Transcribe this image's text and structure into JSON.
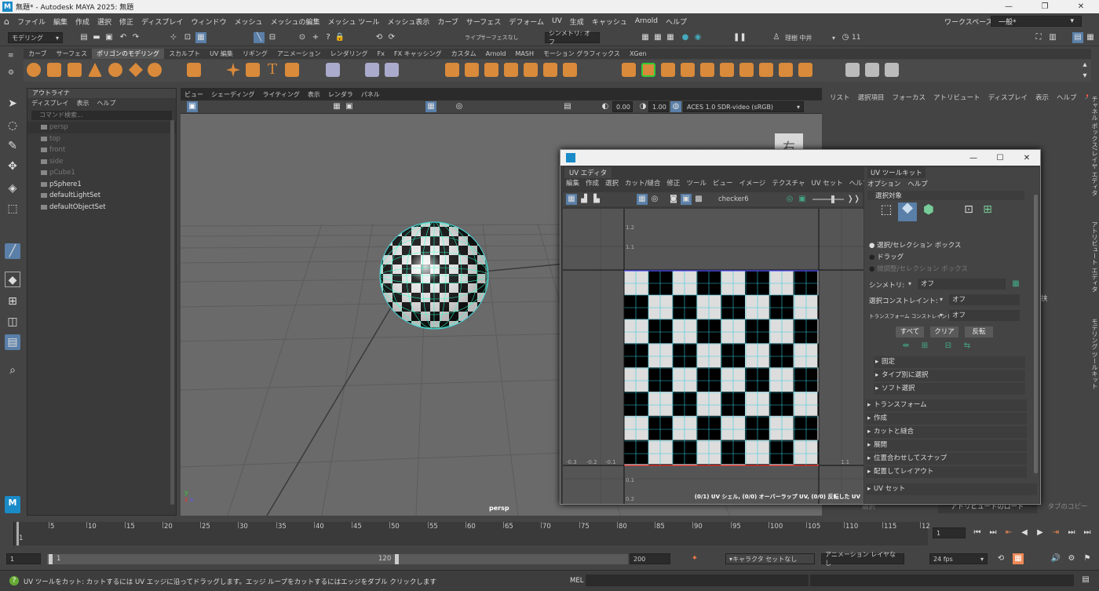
{
  "app": {
    "title": "無題* - Autodesk MAYA 2025: 無題",
    "logo": "M",
    "window_buttons": [
      "—",
      "❐",
      "✕"
    ]
  },
  "menubar": {
    "items": [
      "ファイル",
      "編集",
      "作成",
      "選択",
      "修正",
      "ディスプレイ",
      "ウィンドウ",
      "メッシュ",
      "メッシュの編集",
      "メッシュ ツール",
      "メッシュ表示",
      "カーブ",
      "サーフェス",
      "デフォーム",
      "UV",
      "生成",
      "キャッシュ",
      "Arnold",
      "ヘルプ"
    ],
    "workspace_label": "ワークスペース :",
    "workspace_value": "一般*"
  },
  "statusline": {
    "mode": "モデリング",
    "live": "ライブ",
    "surface": "サーフェスなし",
    "symmetry": "シンメトリ: オフ",
    "user": "理樹 中井",
    "credits": "11"
  },
  "shelf": {
    "tabs": [
      "カーブ",
      "サーフェス",
      "ポリゴンのモデリング",
      "スカルプト",
      "UV 編集",
      "リギング",
      "アニメーション",
      "レンダリング",
      "Fx",
      "FX キャッシング",
      "カスタム",
      "Arnold",
      "MASH",
      "モーション グラフィックス",
      "XGen"
    ],
    "active_tab": "ポリゴンのモデリング"
  },
  "outliner": {
    "title": "アウトライナ",
    "menu": [
      "ディスプレイ",
      "表示",
      "ヘルプ"
    ],
    "search_placeholder": "コマンド検索...",
    "items": [
      {
        "label": "persp",
        "dim": true
      },
      {
        "label": "top",
        "dim": true
      },
      {
        "label": "front",
        "dim": true
      },
      {
        "label": "side",
        "dim": true
      },
      {
        "label": "pCube1",
        "dim": true
      },
      {
        "label": "pSphere1",
        "dim": false
      },
      {
        "label": "defaultLightSet",
        "dim": false
      },
      {
        "label": "defaultObjectSet",
        "dim": false
      }
    ]
  },
  "viewport": {
    "menu": [
      "ビュー",
      "シェーディング",
      "ライティング",
      "表示",
      "レンダラ",
      "パネル"
    ],
    "camera_label": "persp",
    "near": "0.00",
    "far": "1.00",
    "color_space": "ACES 1.0 SDR-video (sRGB)",
    "view_cube_label": "右"
  },
  "channelbox": {
    "menu": [
      "リスト",
      "選択項目",
      "フォーカス",
      "アトリビュート",
      "ディスプレイ",
      "表示",
      "ヘルプ"
    ],
    "side_tabs": [
      "チャネル ボックス/レイヤ エディタ",
      "アトリビュート エディタ",
      "モデリング ツールキット"
    ],
    "partial_label": "挟",
    "bottom_tabs": [
      "選択",
      "アトリビュートのロード",
      "タブのコピー"
    ]
  },
  "uv_editor": {
    "tab": "UV エディタ",
    "menu": [
      "編集",
      "作成",
      "選択",
      "カット/縫合",
      "修正",
      "ツール",
      "ビュー",
      "イメージ",
      "テクスチャ",
      "UV セット",
      "ヘルプ"
    ],
    "texture_name": "checker6",
    "status": "(0/1) UV シェル, (0/0) オーバーラップ UV, (0/0) 反転した UV",
    "axis_labels": {
      "y1_2": "1.2",
      "y1_1": "1.1",
      "y0_1": "0.1",
      "y0_2": "0.2",
      "xm03": "-0.3",
      "xm02": "-0.2",
      "xm01": "-0.1",
      "x1_1": "1.1"
    }
  },
  "uv_toolkit": {
    "tab": "UV ツールキット",
    "menu": [
      "オプション",
      "ヘルプ"
    ],
    "selection_header": "選択対象",
    "options": [
      "選択/セレクション ボックス",
      "ドラッグ",
      "微調整/セレクション ボックス"
    ],
    "symmetry_label": "シンメトリ:",
    "symmetry_value": "オフ",
    "constraint_label": "選択コンストレイント:",
    "constraint_value": "オフ",
    "transform_constraint_label": "トランスフォーム コンストレイント:",
    "transform_constraint_value": "オフ",
    "buttons": [
      "すべて",
      "クリア",
      "反転"
    ],
    "subsections": [
      "固定",
      "タイプ別に選択",
      "ソフト選択"
    ],
    "sections": [
      "トランスフォーム",
      "作成",
      "カットと縫合",
      "展開",
      "位置合わせしてスナップ",
      "配置してレイアウト"
    ],
    "uvset": "UV セット"
  },
  "timeline": {
    "ticks": [
      "1",
      "5",
      "10",
      "15",
      "20",
      "25",
      "30",
      "35",
      "40",
      "45",
      "50",
      "55",
      "60",
      "65",
      "70",
      "75",
      "80",
      "85",
      "90",
      "95",
      "100",
      "105",
      "110",
      "115",
      "12"
    ],
    "current_frame": "1"
  },
  "range": {
    "start": "1",
    "inner_start": "1",
    "inner_end": "120",
    "end": "200",
    "character_set": "キャラクタ セットなし",
    "anim_layer": "アニメーション レイヤなし",
    "fps": "24 fps"
  },
  "helpline": {
    "text": "UV ツールをカット: カットするには UV エッジに沿ってドラッグします。エッジ ループをカットするにはエッジをダブル クリックします",
    "mel": "MEL"
  }
}
